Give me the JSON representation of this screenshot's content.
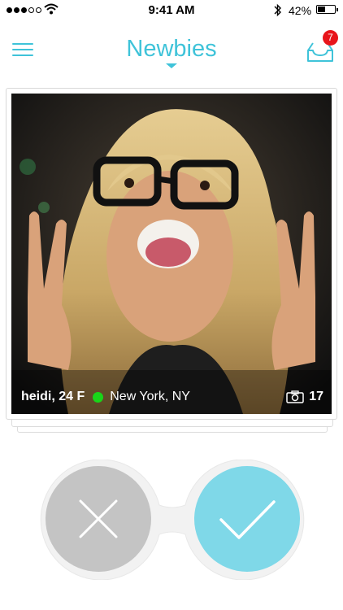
{
  "status_bar": {
    "time": "9:41 AM",
    "battery_percent": "42%",
    "signal_bars": 3,
    "signal_total": 5
  },
  "header": {
    "title": "Newbies",
    "inbox_badge": "7"
  },
  "card": {
    "name_age": "heidi, 24 F",
    "location": "New York, NY",
    "photo_count": "17",
    "online": true
  },
  "actions": {
    "dislike_icon": "close-icon",
    "like_icon": "check-icon"
  },
  "colors": {
    "accent": "#3fc3d9",
    "badge": "#e8151b",
    "online": "#19d419",
    "dislike_button": "#c4c4c4",
    "like_button": "#7fd8e8"
  }
}
